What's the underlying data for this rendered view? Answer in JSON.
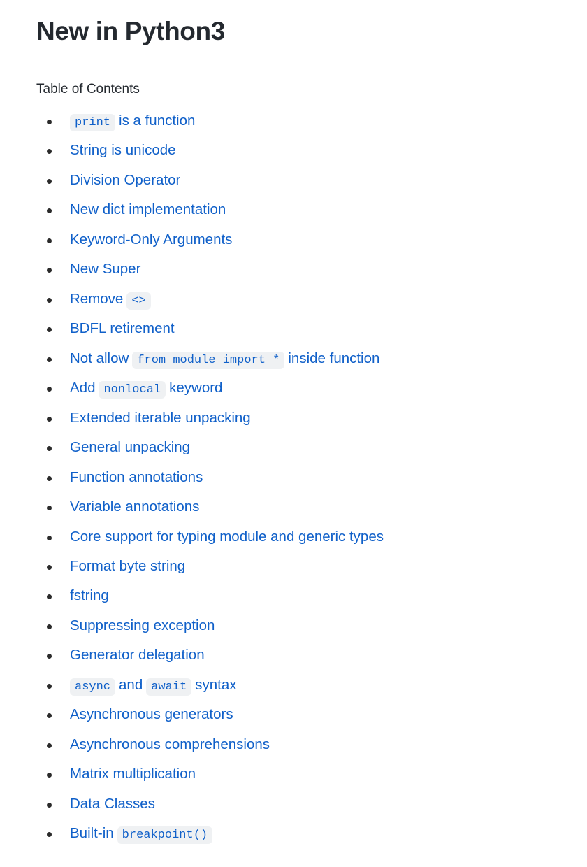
{
  "document": {
    "title": "New in Python3",
    "toc_heading": "Table of Contents",
    "link_color": "#1060c9",
    "text_color": "#24292f",
    "code_background": "#eff1f3",
    "rule_color": "#e8eaed",
    "bullet_color": "#2b2b2b"
  },
  "toc_items": [
    {
      "segments": [
        {
          "type": "code",
          "text": "print"
        },
        {
          "type": "text",
          "text": "is a function"
        }
      ]
    },
    {
      "segments": [
        {
          "type": "text",
          "text": "String is unicode"
        }
      ]
    },
    {
      "segments": [
        {
          "type": "text",
          "text": "Division Operator"
        }
      ]
    },
    {
      "segments": [
        {
          "type": "text",
          "text": "New dict implementation"
        }
      ]
    },
    {
      "segments": [
        {
          "type": "text",
          "text": "Keyword-Only Arguments"
        }
      ]
    },
    {
      "segments": [
        {
          "type": "text",
          "text": "New Super"
        }
      ]
    },
    {
      "segments": [
        {
          "type": "text",
          "text": "Remove"
        },
        {
          "type": "code",
          "text": "<>"
        }
      ]
    },
    {
      "segments": [
        {
          "type": "text",
          "text": "BDFL retirement"
        }
      ]
    },
    {
      "segments": [
        {
          "type": "text",
          "text": "Not allow"
        },
        {
          "type": "code",
          "text": "from module import *"
        },
        {
          "type": "text",
          "text": "inside function"
        }
      ]
    },
    {
      "segments": [
        {
          "type": "text",
          "text": "Add"
        },
        {
          "type": "code",
          "text": "nonlocal"
        },
        {
          "type": "text",
          "text": "keyword"
        }
      ]
    },
    {
      "segments": [
        {
          "type": "text",
          "text": "Extended iterable unpacking"
        }
      ]
    },
    {
      "segments": [
        {
          "type": "text",
          "text": "General unpacking"
        }
      ]
    },
    {
      "segments": [
        {
          "type": "text",
          "text": "Function annotations"
        }
      ]
    },
    {
      "segments": [
        {
          "type": "text",
          "text": "Variable annotations"
        }
      ]
    },
    {
      "segments": [
        {
          "type": "text",
          "text": "Core support for typing module and generic types"
        }
      ]
    },
    {
      "segments": [
        {
          "type": "text",
          "text": "Format byte string"
        }
      ]
    },
    {
      "segments": [
        {
          "type": "text",
          "text": "fstring"
        }
      ]
    },
    {
      "segments": [
        {
          "type": "text",
          "text": "Suppressing exception"
        }
      ]
    },
    {
      "segments": [
        {
          "type": "text",
          "text": "Generator delegation"
        }
      ]
    },
    {
      "segments": [
        {
          "type": "code",
          "text": "async"
        },
        {
          "type": "text",
          "text": "and"
        },
        {
          "type": "code",
          "text": "await"
        },
        {
          "type": "text",
          "text": "syntax"
        }
      ]
    },
    {
      "segments": [
        {
          "type": "text",
          "text": "Asynchronous generators"
        }
      ]
    },
    {
      "segments": [
        {
          "type": "text",
          "text": "Asynchronous comprehensions"
        }
      ]
    },
    {
      "segments": [
        {
          "type": "text",
          "text": "Matrix multiplication"
        }
      ]
    },
    {
      "segments": [
        {
          "type": "text",
          "text": "Data Classes"
        }
      ]
    },
    {
      "segments": [
        {
          "type": "text",
          "text": "Built-in"
        },
        {
          "type": "code",
          "text": "breakpoint()"
        }
      ]
    }
  ]
}
